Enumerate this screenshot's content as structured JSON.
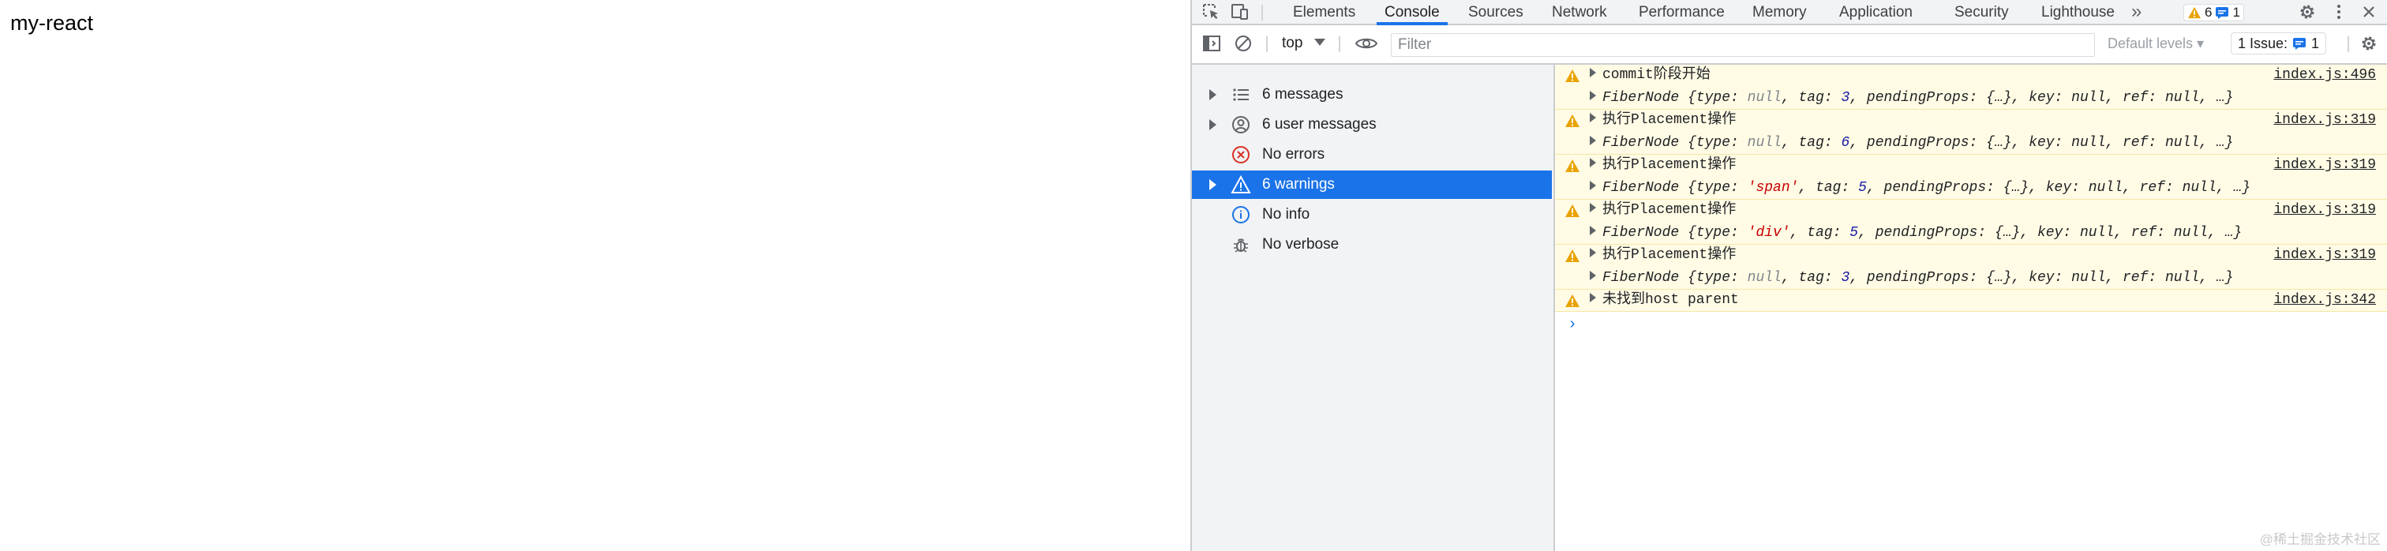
{
  "page": {
    "title": "my-react",
    "watermark": "@稀土掘金技术社区"
  },
  "devtools": {
    "tabs": [
      "Elements",
      "Console",
      "Sources",
      "Network",
      "Performance",
      "Memory",
      "Application",
      "Security",
      "Lighthouse"
    ],
    "active_tab": "Console",
    "more_tabs_icon": "»",
    "warning_count": "6",
    "message_count": "1",
    "toolbar": {
      "context": "top",
      "filter_placeholder": "Filter",
      "levels": "Default levels ▾",
      "issues_label": "1 Issue:",
      "issues_count": "1"
    },
    "sidebar": [
      {
        "label": "6 messages",
        "icon": "list-icon",
        "expandable": true,
        "selected": false
      },
      {
        "label": "6 user messages",
        "icon": "user-icon",
        "expandable": true,
        "selected": false
      },
      {
        "label": "No errors",
        "icon": "error-icon",
        "expandable": false,
        "selected": false
      },
      {
        "label": "6 warnings",
        "icon": "warning-icon",
        "expandable": true,
        "selected": true
      },
      {
        "label": "No info",
        "icon": "info-icon",
        "expandable": false,
        "selected": false
      },
      {
        "label": "No verbose",
        "icon": "bug-icon",
        "expandable": false,
        "selected": false
      }
    ],
    "messages": [
      {
        "text": "commit阶段开始",
        "source": "index.js:496",
        "fiber": {
          "type": "null",
          "tag": "3"
        }
      },
      {
        "text": "执行Placement操作",
        "source": "index.js:319",
        "fiber": {
          "type": "null",
          "tag": "6"
        }
      },
      {
        "text": "执行Placement操作",
        "source": "index.js:319",
        "fiber": {
          "type": "'span'",
          "tag": "5"
        }
      },
      {
        "text": "执行Placement操作",
        "source": "index.js:319",
        "fiber": {
          "type": "'div'",
          "tag": "5"
        }
      },
      {
        "text": "执行Placement操作",
        "source": "index.js:319",
        "fiber": {
          "type": "null",
          "tag": "3"
        }
      },
      {
        "text": "未找到host parent",
        "source": "index.js:342"
      }
    ],
    "fiber_label": "FiberNode",
    "fiber_rest": "pendingProps: {…}, key: null, ref: null, …}",
    "prompt": "›",
    "colors": {
      "accent": "#1a73e8",
      "warning_bg": "#fffbe5",
      "warning_icon": "#e8a300"
    }
  }
}
